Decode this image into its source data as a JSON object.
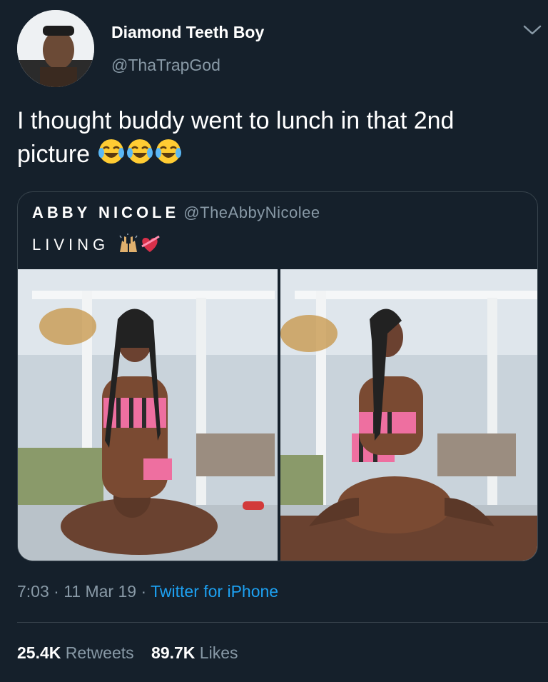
{
  "tweet": {
    "display_name": "Diamond Teeth Boy",
    "handle": "@ThaTrapGod",
    "text": "I thought buddy went to lunch in that 2nd picture",
    "text_emoji": [
      "face-with-tears-of-joy-icon",
      "face-with-tears-of-joy-icon",
      "face-with-tears-of-joy-icon"
    ],
    "time": "7:03",
    "date": "11 Mar 19",
    "separator": "·",
    "source": "Twitter for iPhone"
  },
  "quoted": {
    "display_name": "ABBY NICOLE",
    "handle": "@TheAbbyNicolee",
    "text": "LIVING",
    "text_emoji": [
      "raising-hands-icon",
      "heart-with-ribbon-icon"
    ]
  },
  "stats": {
    "retweets_count": "25.4K",
    "retweets_label": "Retweets",
    "likes_count": "89.7K",
    "likes_label": "Likes"
  },
  "colors": {
    "background": "#15202b",
    "secondary_text": "#8899a6",
    "accent": "#1da1f2",
    "border": "#38444d"
  }
}
